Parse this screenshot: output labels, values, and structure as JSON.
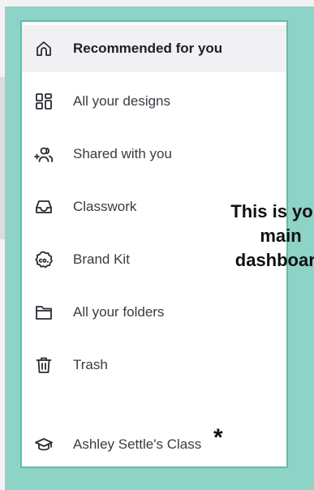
{
  "menu": {
    "items": [
      {
        "label": "Recommended for you",
        "icon": "home-icon",
        "active": true
      },
      {
        "label": "All your designs",
        "icon": "grid-icon",
        "active": false
      },
      {
        "label": "Shared with you",
        "icon": "shared-users-icon",
        "active": false
      },
      {
        "label": "Classwork",
        "icon": "inbox-tray-icon",
        "active": false
      },
      {
        "label": "Brand Kit",
        "icon": "brand-kit-icon",
        "active": false
      },
      {
        "label": "All your folders",
        "icon": "folder-icon",
        "active": false
      },
      {
        "label": "Trash",
        "icon": "trash-icon",
        "active": false
      },
      {
        "label": "Ashley Settle's Class",
        "icon": "graduation-cap-icon",
        "active": false
      }
    ]
  },
  "annotation": {
    "callout_text": "This is your\nmain\ndashboard",
    "asterisk": "*"
  },
  "colors": {
    "teal_background": "#8dd3c6",
    "panel_border": "#5bbfad",
    "active_row": "#f1f1f3"
  }
}
